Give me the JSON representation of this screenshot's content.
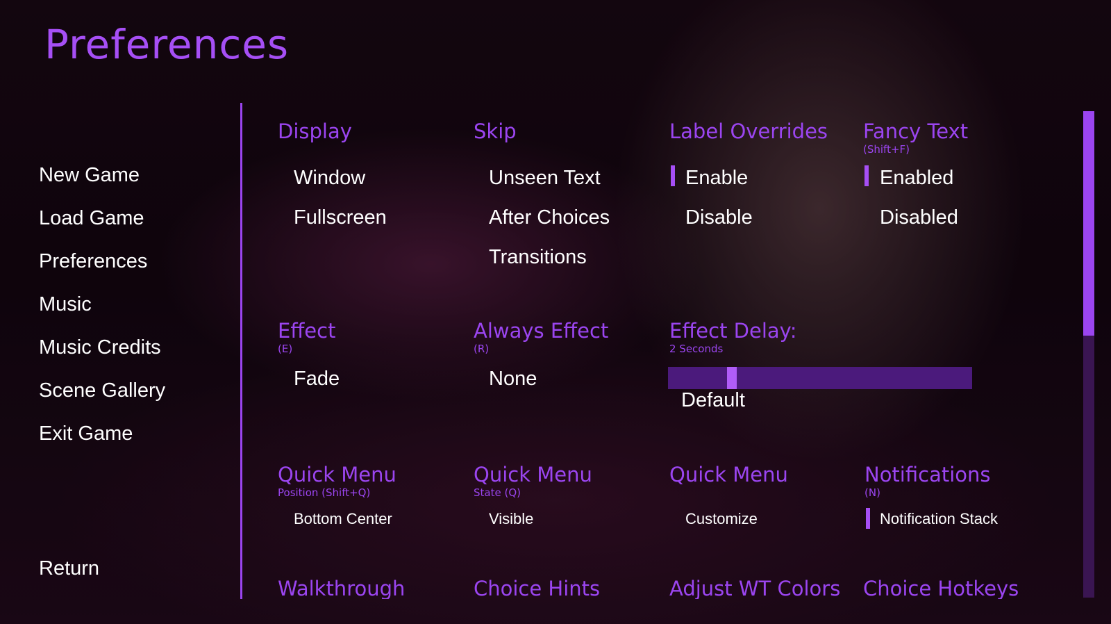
{
  "page_title": "Preferences",
  "nav": {
    "items": [
      "New Game",
      "Load Game",
      "Preferences",
      "Music",
      "Music Credits",
      "Scene Gallery",
      "Exit Game"
    ],
    "return_label": "Return"
  },
  "sections": {
    "display": {
      "title": "Display",
      "options": [
        "Window",
        "Fullscreen"
      ]
    },
    "skip": {
      "title": "Skip",
      "options": [
        "Unseen Text",
        "After Choices",
        "Transitions"
      ]
    },
    "label_overrides": {
      "title": "Label Overrides",
      "options": [
        "Enable",
        "Disable"
      ],
      "selected": "Enable"
    },
    "fancy_text": {
      "title": "Fancy Text",
      "subtitle": "(Shift+F)",
      "options": [
        "Enabled",
        "Disabled"
      ],
      "selected": "Enabled"
    },
    "effect": {
      "title": "Effect",
      "subtitle": "(E)",
      "value": "Fade"
    },
    "always_effect": {
      "title": "Always Effect",
      "subtitle": "(R)",
      "value": "None"
    },
    "effect_delay": {
      "title": "Effect Delay:",
      "subtitle": "2 Seconds",
      "slider_fraction": 0.2,
      "default_label": "Default"
    },
    "quick_menu_position": {
      "title": "Quick Menu",
      "subtitle": "Position (Shift+Q)",
      "value": "Bottom Center"
    },
    "quick_menu_state": {
      "title": "Quick Menu",
      "subtitle": "State (Q)",
      "value": "Visible"
    },
    "quick_menu_customize": {
      "title": "Quick Menu",
      "value": "Customize"
    },
    "notifications": {
      "title": "Notifications",
      "subtitle": "(N)",
      "value": "Notification Stack"
    },
    "row4": [
      "Walkthrough",
      "Choice Hints",
      "Adjust WT Colors",
      "Choice Hotkeys"
    ]
  },
  "colors": {
    "accent": "#9b45f0",
    "text": "#ffffff"
  },
  "scrollbar": {
    "position_fraction": 0.0
  }
}
